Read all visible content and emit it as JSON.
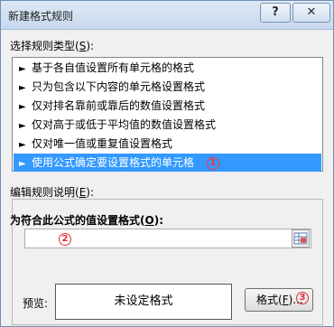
{
  "window": {
    "title": "新建格式规则",
    "help_label": "?",
    "close_label": "✕"
  },
  "rule_type": {
    "label_prefix": "选择规则类型(",
    "label_key": "S",
    "label_suffix": "):",
    "items": [
      {
        "label": "基于各自值设置所有单元格的格式",
        "selected": false
      },
      {
        "label": "只为包含以下内容的单元格设置格式",
        "selected": false
      },
      {
        "label": "仅对排名靠前或靠后的数值设置格式",
        "selected": false
      },
      {
        "label": "仅对高于或低于平均值的数值设置格式",
        "selected": false
      },
      {
        "label": "仅对唯一值或重复值设置格式",
        "selected": false
      },
      {
        "label": "使用公式确定要设置格式的单元格",
        "selected": true
      }
    ],
    "arrow": "►"
  },
  "description": {
    "label_prefix": "编辑规则说明(",
    "label_key": "E",
    "label_suffix": "):",
    "formula_label_prefix": "为符合此公式的值设置格式(",
    "formula_label_key": "O",
    "formula_label_suffix": "):",
    "formula_value": ""
  },
  "preview": {
    "label": "预览:",
    "text": "未设定格式"
  },
  "format_button": {
    "label_prefix": "格式(",
    "label_key": "F",
    "label_suffix": ")..."
  },
  "annotations": {
    "badge_1": "1",
    "badge_2": "2",
    "badge_3": "3"
  },
  "colors": {
    "selection": "#3399ff",
    "annotation": "#e0303a"
  }
}
